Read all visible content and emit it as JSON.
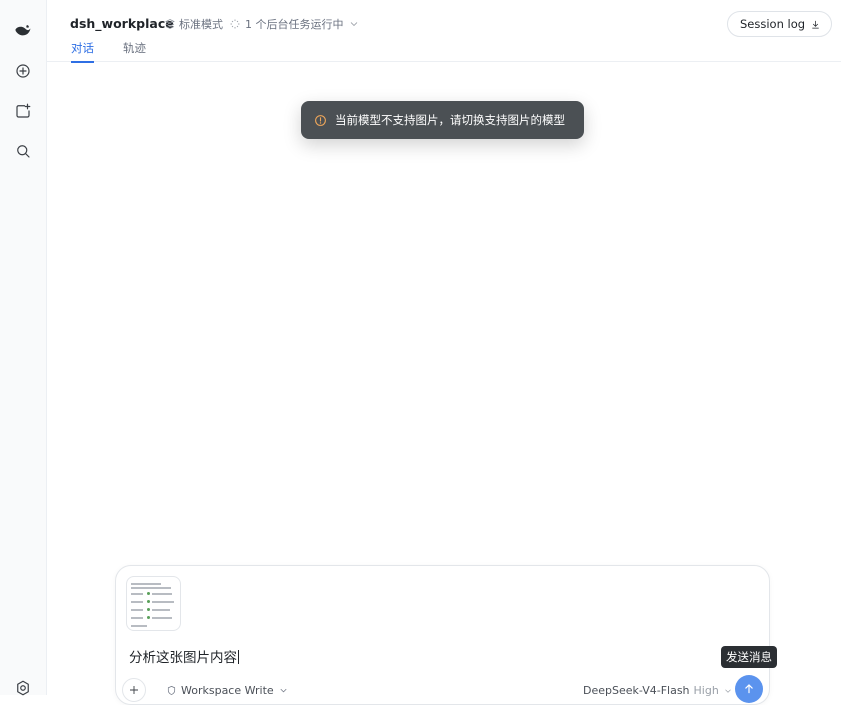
{
  "header": {
    "workspace_name": "dsh_workplace",
    "mode_label": "标准模式",
    "background_tasks": "1 个后台任务运行中",
    "tabs": [
      {
        "label": "对话",
        "active": true
      },
      {
        "label": "轨迹",
        "active": false
      }
    ],
    "session_log_label": "Session log"
  },
  "sidebar": {
    "icons": [
      "app-logo-icon",
      "new-chat-icon",
      "add-project-icon",
      "search-icon",
      "settings-icon"
    ]
  },
  "toast": {
    "message": "当前模型不支持图片，请切换支持图片的模型",
    "icon": "warning-icon",
    "icon_color": "#f0a75a"
  },
  "composer": {
    "attachment": "image-thumbnail",
    "input_value": "分析这张图片内容",
    "permission_label": "Workspace Write",
    "model_name": "DeepSeek-V4-Flash",
    "model_level": "High",
    "send_tooltip": "发送消息",
    "accent_color": "#5b93ee"
  }
}
